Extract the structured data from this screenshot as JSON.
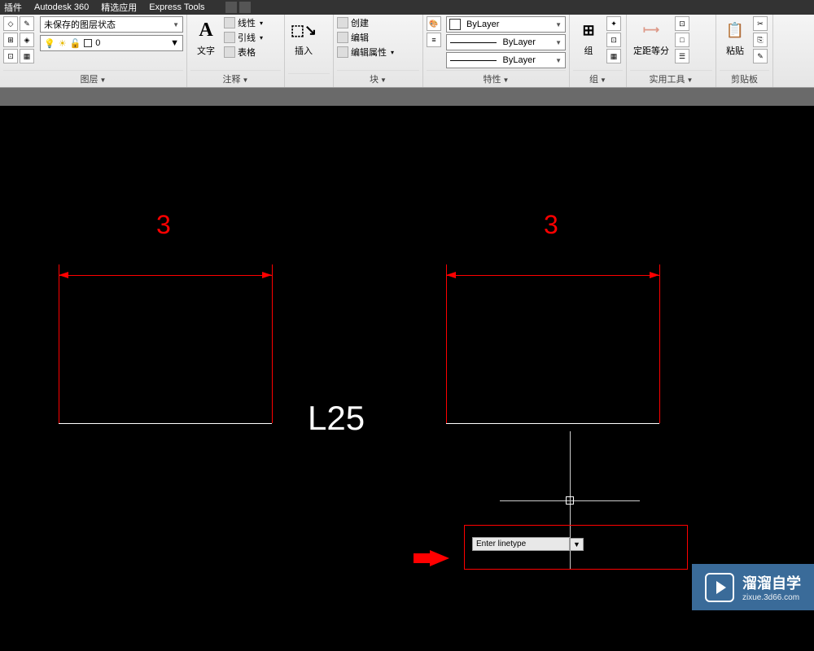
{
  "menu": {
    "items": [
      "插件",
      "Autodesk 360",
      "精选应用",
      "Express Tools"
    ]
  },
  "ribbon": {
    "layer": {
      "title": "图层",
      "state_label": "未保存的图层状态",
      "current": "0"
    },
    "annotate": {
      "title": "注释",
      "text_label": "文字",
      "items": [
        "线性",
        "引线",
        "表格"
      ]
    },
    "insert": {
      "title": "插入",
      "label": "插入"
    },
    "block": {
      "title": "块",
      "items": [
        "创建",
        "编辑",
        "编辑属性"
      ]
    },
    "props": {
      "title": "特性",
      "color": "ByLayer",
      "linetype": "ByLayer",
      "lineweight": "ByLayer"
    },
    "group": {
      "title": "组",
      "label": "组"
    },
    "util": {
      "title": "实用工具",
      "label": "定距等分"
    },
    "clip": {
      "title": "剪贴板",
      "label": "粘贴"
    }
  },
  "drawing": {
    "dim_left": "3",
    "dim_right": "3",
    "label": "L25"
  },
  "dynamic_input": {
    "prompt": "Enter linetype"
  },
  "watermark": {
    "title": "溜溜自学",
    "url": "zixue.3d66.com"
  }
}
